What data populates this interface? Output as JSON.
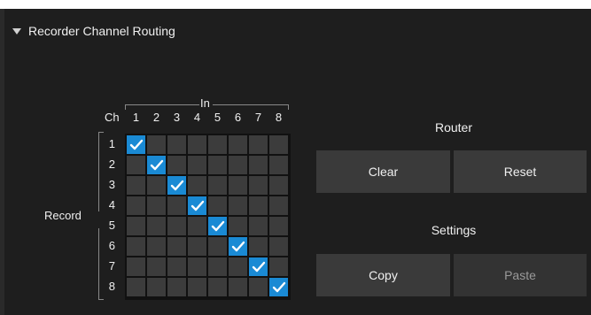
{
  "section": {
    "title": "Recorder Channel Routing",
    "icon": "triangle-down-icon"
  },
  "matrix": {
    "in_label": "In",
    "ch_label": "Ch",
    "record_label": "Record",
    "columns": [
      "1",
      "2",
      "3",
      "4",
      "5",
      "6",
      "7",
      "8"
    ],
    "rows": [
      "1",
      "2",
      "3",
      "4",
      "5",
      "6",
      "7",
      "8"
    ],
    "routing": [
      [
        1,
        0,
        0,
        0,
        0,
        0,
        0,
        0
      ],
      [
        0,
        1,
        0,
        0,
        0,
        0,
        0,
        0
      ],
      [
        0,
        0,
        1,
        0,
        0,
        0,
        0,
        0
      ],
      [
        0,
        0,
        0,
        1,
        0,
        0,
        0,
        0
      ],
      [
        0,
        0,
        0,
        0,
        1,
        0,
        0,
        0
      ],
      [
        0,
        0,
        0,
        0,
        0,
        1,
        0,
        0
      ],
      [
        0,
        0,
        0,
        0,
        0,
        0,
        1,
        0
      ],
      [
        0,
        0,
        0,
        0,
        0,
        0,
        0,
        1
      ]
    ],
    "on_color": "#1a8ad4"
  },
  "router": {
    "label": "Router",
    "clear_label": "Clear",
    "reset_label": "Reset"
  },
  "settings": {
    "label": "Settings",
    "copy_label": "Copy",
    "paste_label": "Paste"
  }
}
